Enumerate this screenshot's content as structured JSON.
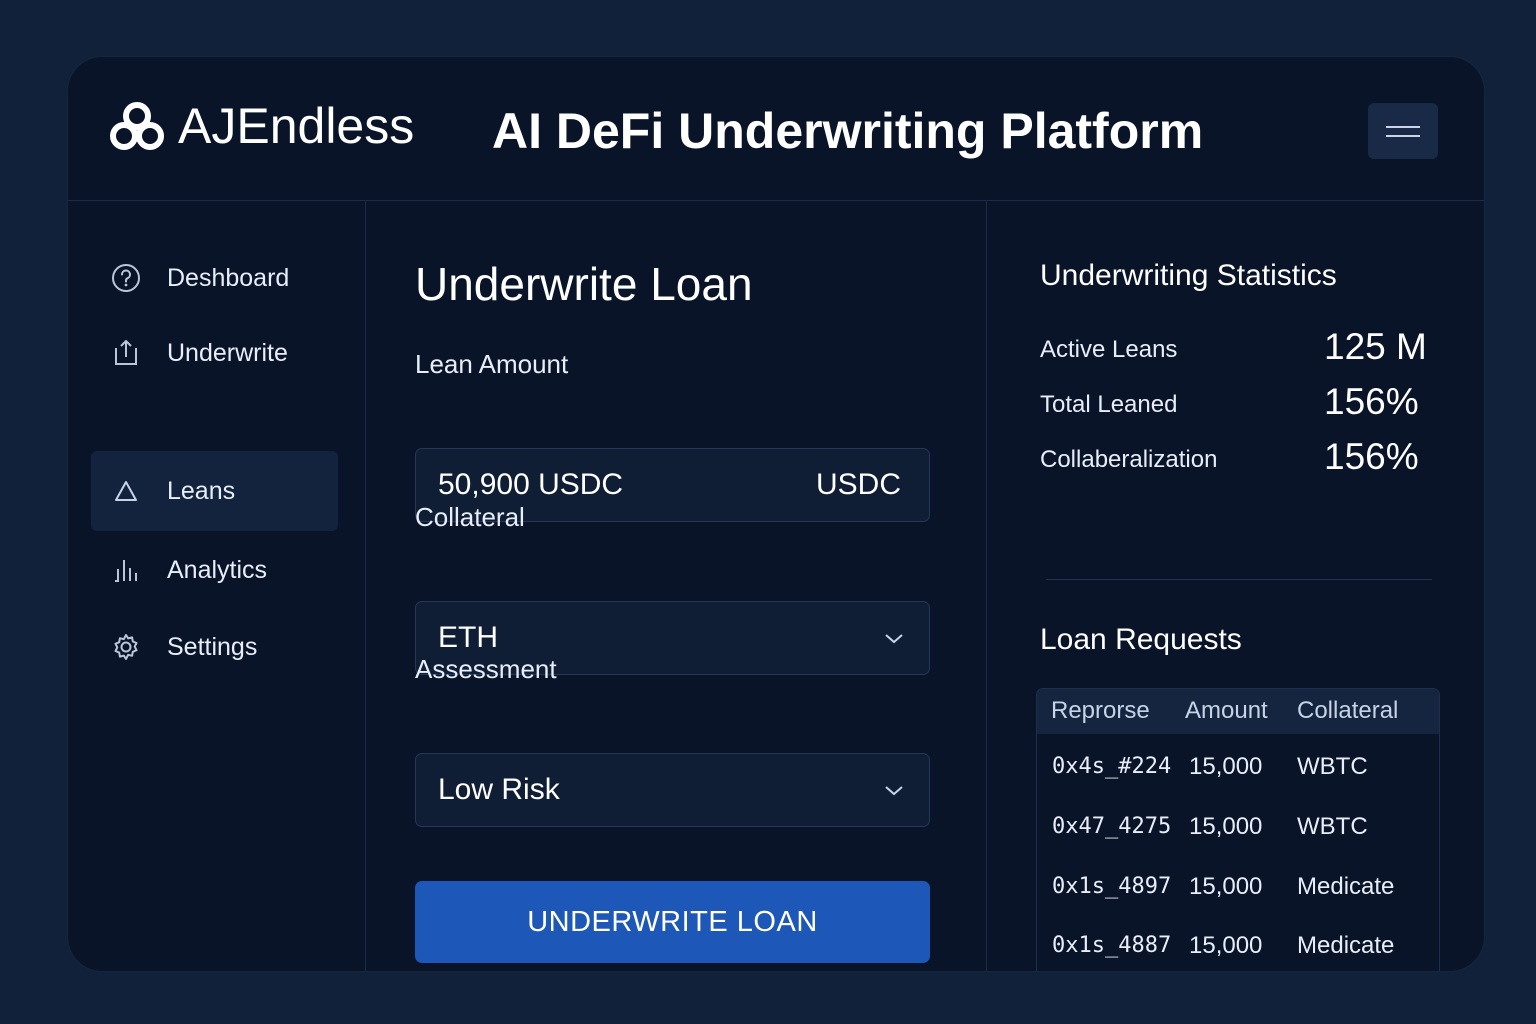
{
  "header": {
    "brand": "AJEndless",
    "title": "AI DeFi Underwriting Platform",
    "menu_icon": "hamburger-menu-icon"
  },
  "sidebar": {
    "items": [
      {
        "label": "Deshboard",
        "icon": "help-circle-icon",
        "active": false
      },
      {
        "label": "Underwrite",
        "icon": "share-upload-icon",
        "active": false
      },
      {
        "label": "Leans",
        "icon": "triangle-icon",
        "active": true
      },
      {
        "label": "Analytics",
        "icon": "bar-chart-icon",
        "active": false
      },
      {
        "label": "Settings",
        "icon": "gear-icon",
        "active": false
      }
    ]
  },
  "form": {
    "title": "Underwrite Loan",
    "amount_label": "Lean Amount",
    "amount_value": "50,900 USDC",
    "amount_suffix": "USDC",
    "collateral_label": "Collateral",
    "collateral_value": "ETH",
    "assessment_label": "Assessment",
    "assessment_value": "Low Risk",
    "submit_label": "UNDERWRITE LOAN"
  },
  "stats": {
    "title": "Underwriting Statistics",
    "rows": [
      {
        "label": "Active Leans",
        "value": "125 M"
      },
      {
        "label": "Total Leaned",
        "value": "156%"
      },
      {
        "label": "Collaberalization",
        "value": "156%"
      }
    ]
  },
  "requests": {
    "title": "Loan Requests",
    "columns": [
      "Reprorse",
      "Amount",
      "Collateral"
    ],
    "rows": [
      [
        "0x4s_#224",
        "15,000",
        "WBTC"
      ],
      [
        "0x47_4275",
        "15,000",
        "WBTC"
      ],
      [
        "0x1s_4897",
        "15,000",
        "Medicate"
      ],
      [
        "0x1s_4887",
        "15,000",
        "Medicate"
      ]
    ]
  },
  "colors": {
    "background": "#12213a",
    "panel": "#0a1428",
    "accent": "#1d58b8"
  }
}
